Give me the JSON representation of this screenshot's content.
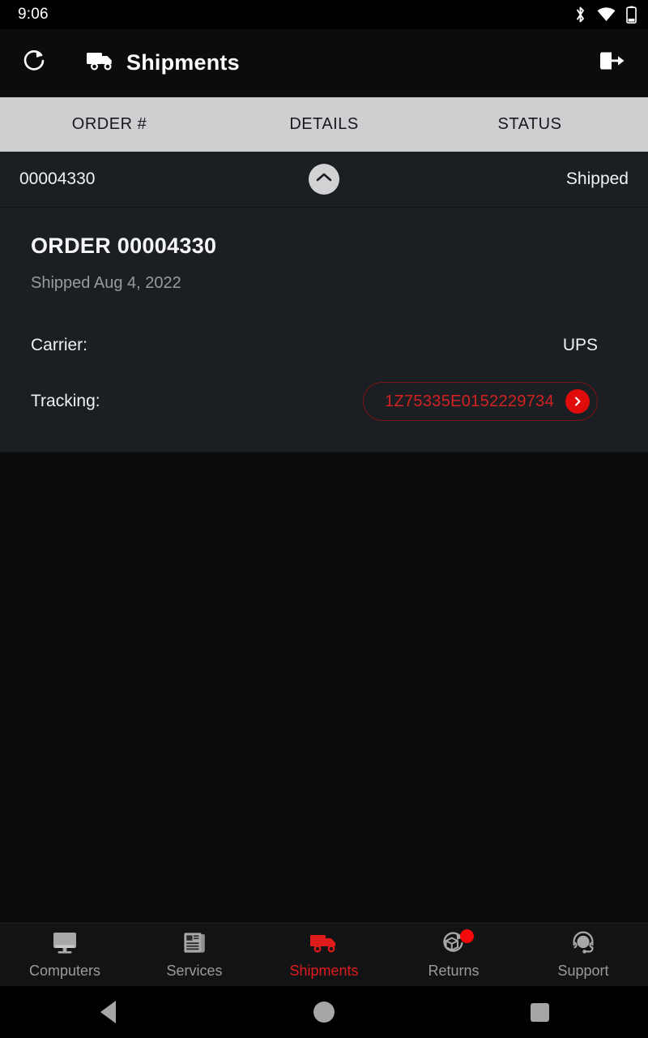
{
  "status_bar": {
    "time": "9:06",
    "icons": [
      "bluetooth-icon",
      "wifi-icon",
      "battery-icon"
    ]
  },
  "app_bar": {
    "refresh_icon": "refresh-icon",
    "brand_icon": "truck-icon",
    "title": "Shipments",
    "logout_icon": "logout-icon"
  },
  "table": {
    "columns": [
      "ORDER #",
      "DETAILS",
      "STATUS"
    ],
    "rows": [
      {
        "order_number": "00004330",
        "status": "Shipped",
        "expanded": true,
        "toggle_icon": "chevron-up-icon"
      }
    ]
  },
  "detail": {
    "title": "ORDER 00004330",
    "subtitle": "Shipped Aug 4, 2022",
    "carrier_label": "Carrier:",
    "carrier_value": "UPS",
    "tracking_label": "Tracking:",
    "tracking_number": "1Z75335E0152229734",
    "tracking_go_icon": "chevron-right-icon"
  },
  "bottom_nav": {
    "items": [
      {
        "label": "Computers",
        "icon": "monitor-icon",
        "active": false,
        "badge": false
      },
      {
        "label": "Services",
        "icon": "newspaper-icon",
        "active": false,
        "badge": false
      },
      {
        "label": "Shipments",
        "icon": "truck-icon",
        "active": true,
        "badge": false
      },
      {
        "label": "Returns",
        "icon": "return-box-icon",
        "active": false,
        "badge": true
      },
      {
        "label": "Support",
        "icon": "headset-icon",
        "active": false,
        "badge": false
      }
    ]
  },
  "android_nav": {
    "back": "back-triangle-icon",
    "home": "home-circle-icon",
    "recents": "recents-square-icon"
  },
  "colors": {
    "accent_red": "#e01b1b",
    "tracking_red": "#d32222",
    "header_bg": "#cfcfd2",
    "row_bg": "#1b1f23",
    "page_bg": "#0c0c0c",
    "muted_text": "#9a9a9a"
  }
}
